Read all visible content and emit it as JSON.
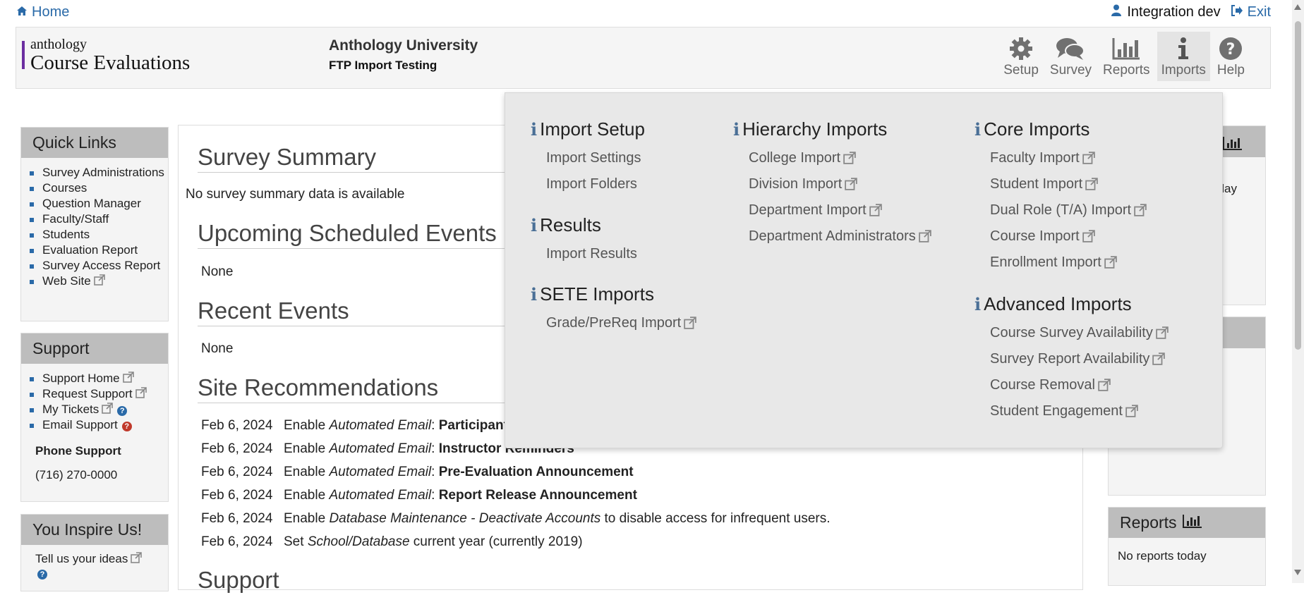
{
  "topbar": {
    "home_label": "Home",
    "user_name": "Integration dev",
    "exit_label": "Exit"
  },
  "header": {
    "logo_top": "anthology",
    "logo_main": "Course Evaluations",
    "institution_name": "Anthology University",
    "institution_sub": "FTP Import Testing"
  },
  "nav": [
    {
      "label": "Setup",
      "icon": "gear-icon"
    },
    {
      "label": "Survey",
      "icon": "chat-bubbles-icon"
    },
    {
      "label": "Reports",
      "icon": "bar-chart-icon"
    },
    {
      "label": "Imports",
      "icon": "info-icon",
      "active": true
    },
    {
      "label": "Help",
      "icon": "question-icon"
    }
  ],
  "quick_links": {
    "title": "Quick Links",
    "items": [
      "Survey Administrations",
      "Courses",
      "Question Manager",
      "Faculty/Staff",
      "Students",
      "Evaluation Report",
      "Survey Access Report",
      "Web Site"
    ]
  },
  "support": {
    "title": "Support",
    "items": [
      "Support Home",
      "Request Support",
      "My Tickets",
      "Email Support"
    ],
    "phone_label": "Phone Support",
    "phone_number": "(716) 270-0000"
  },
  "inspire": {
    "title": "You Inspire Us!",
    "link": "Tell us your ideas"
  },
  "main": {
    "survey_summary_title": "Survey Summary",
    "survey_summary_text": "No survey summary data is available",
    "upcoming_title": "Upcoming Scheduled Events",
    "upcoming_text": "None",
    "recent_title": "Recent Events",
    "recent_text": "None",
    "recommendations_title": "Site Recommendations",
    "recommendations": [
      {
        "date": "Feb 6, 2024",
        "prefix": "Enable ",
        "em": "Automated Email",
        "mid": ": ",
        "strong": "Participant Reminders",
        "suffix": ""
      },
      {
        "date": "Feb 6, 2024",
        "prefix": "Enable ",
        "em": "Automated Email",
        "mid": ": ",
        "strong": "Instructor Reminders",
        "suffix": ""
      },
      {
        "date": "Feb 6, 2024",
        "prefix": "Enable ",
        "em": "Automated Email",
        "mid": ": ",
        "strong": "Pre-Evaluation Announcement",
        "suffix": ""
      },
      {
        "date": "Feb 6, 2024",
        "prefix": "Enable ",
        "em": "Automated Email",
        "mid": ": ",
        "strong": "Report Release Announcement",
        "suffix": ""
      },
      {
        "date": "Feb 6, 2024",
        "prefix": "Enable ",
        "em": "Database Maintenance - Deactivate Accounts",
        "mid": " to disable access for infrequent users.",
        "strong": "",
        "suffix": ""
      },
      {
        "date": "Feb 6, 2024",
        "prefix": "Set ",
        "em": "School/Database",
        "mid": " current year (currently 2019)",
        "strong": "",
        "suffix": ""
      }
    ],
    "support_title": "Support"
  },
  "right": {
    "partial_text": "lay",
    "reports_title": "Reports",
    "reports_text": "No reports today"
  },
  "imports_menu": {
    "import_setup": {
      "title": "Import Setup",
      "links": [
        "Import Settings",
        "Import Folders"
      ]
    },
    "results": {
      "title": "Results",
      "links": [
        "Import Results"
      ]
    },
    "sete": {
      "title": "SETE Imports",
      "links": [
        "Grade/PreReq Import"
      ]
    },
    "hierarchy": {
      "title": "Hierarchy Imports",
      "links": [
        "College Import",
        "Division Import",
        "Department Import",
        "Department Administrators"
      ]
    },
    "core": {
      "title": "Core Imports",
      "links": [
        "Faculty Import",
        "Student Import",
        "Dual Role (T/A) Import",
        "Course Import",
        "Enrollment Import"
      ]
    },
    "advanced": {
      "title": "Advanced Imports",
      "links": [
        "Course Survey Availability",
        "Survey Report Availability",
        "Course Removal",
        "Student Engagement"
      ]
    }
  },
  "colors": {
    "link": "#2a6aa8",
    "logo_bar": "#6b2ea0",
    "panel_head": "#bdbdbd",
    "menu_bg": "#e8e8e8",
    "help_red": "#c0392b"
  }
}
